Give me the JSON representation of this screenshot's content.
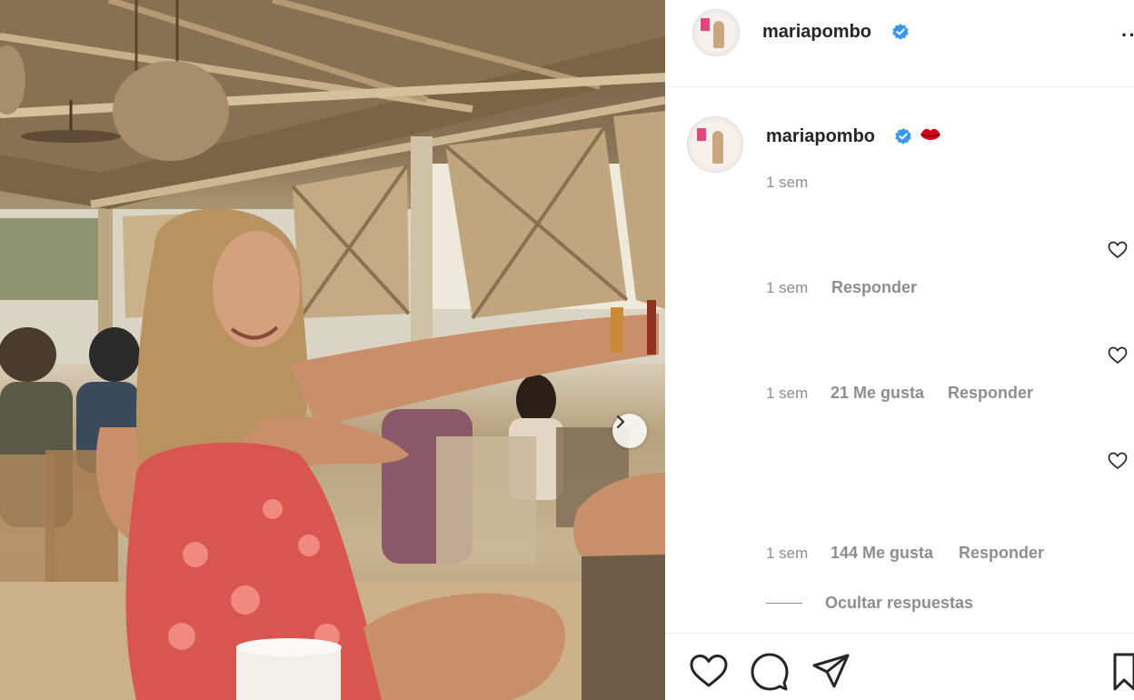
{
  "post": {
    "author": {
      "username": "mariapombo",
      "verified": true,
      "verified_color": "#3897f0"
    },
    "photo": {
      "next_arrow_icon": "chevron-right-icon"
    },
    "more_icon": "more-horizontal-icon"
  },
  "caption": {
    "username": "mariapombo",
    "emoji": "kiss-lips-icon",
    "time": "1 sem"
  },
  "comments": [
    {
      "time": "1 sem",
      "likes": "",
      "reply_label": "Responder"
    },
    {
      "time": "1 sem",
      "likes": "21 Me gusta",
      "reply_label": "Responder"
    },
    {
      "time": "1 sem",
      "likes": "144 Me gusta",
      "reply_label": "Responder"
    }
  ],
  "replies_toggle": {
    "label": "Ocultar respuestas"
  },
  "action_bar": {
    "icons": [
      "heart-icon",
      "comment-icon",
      "share-icon",
      "bookmark-icon"
    ]
  },
  "colors": {
    "text": "#262626",
    "muted": "#8e8e8e",
    "border": "#efefef",
    "accent": "#3897f0",
    "kiss": "#d0021b"
  }
}
